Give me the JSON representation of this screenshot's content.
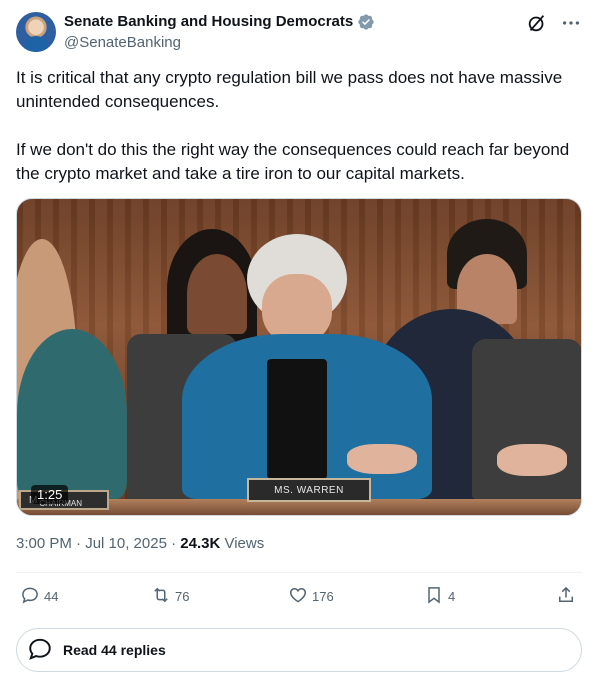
{
  "author": {
    "name": "Senate Banking and Housing Democrats",
    "handle": "@SenateBanking"
  },
  "tweet": {
    "paragraph1": "It is critical that any crypto regulation bill we pass does not have massive unintended consequences.",
    "paragraph2": "If we don't do this the right way the consequences could reach far beyond the crypto market and take a tire iron to our capital markets."
  },
  "media": {
    "duration": "1:25",
    "nameplate": "MS. WARREN",
    "chairman_plate": "M",
    "chairman_subtitle": "CHAIRMAN"
  },
  "meta": {
    "time": "3:00 PM · Jul 10, 2025 · ",
    "views_count": "24.3K",
    "views_label": " Views"
  },
  "actions": {
    "replies": "44",
    "reposts": "76",
    "likes": "176",
    "bookmarks": "4"
  },
  "replies_button": {
    "label": "Read 44 replies"
  },
  "colors": {
    "text": "#0f1419",
    "secondary": "#536471",
    "verified": "#829aab",
    "border": "#cfd9de"
  },
  "icons": [
    "verified-icon",
    "grok-icon",
    "more-icon",
    "reply-icon",
    "repost-icon",
    "like-icon",
    "bookmark-icon",
    "share-icon",
    "speech-bubble-icon"
  ]
}
